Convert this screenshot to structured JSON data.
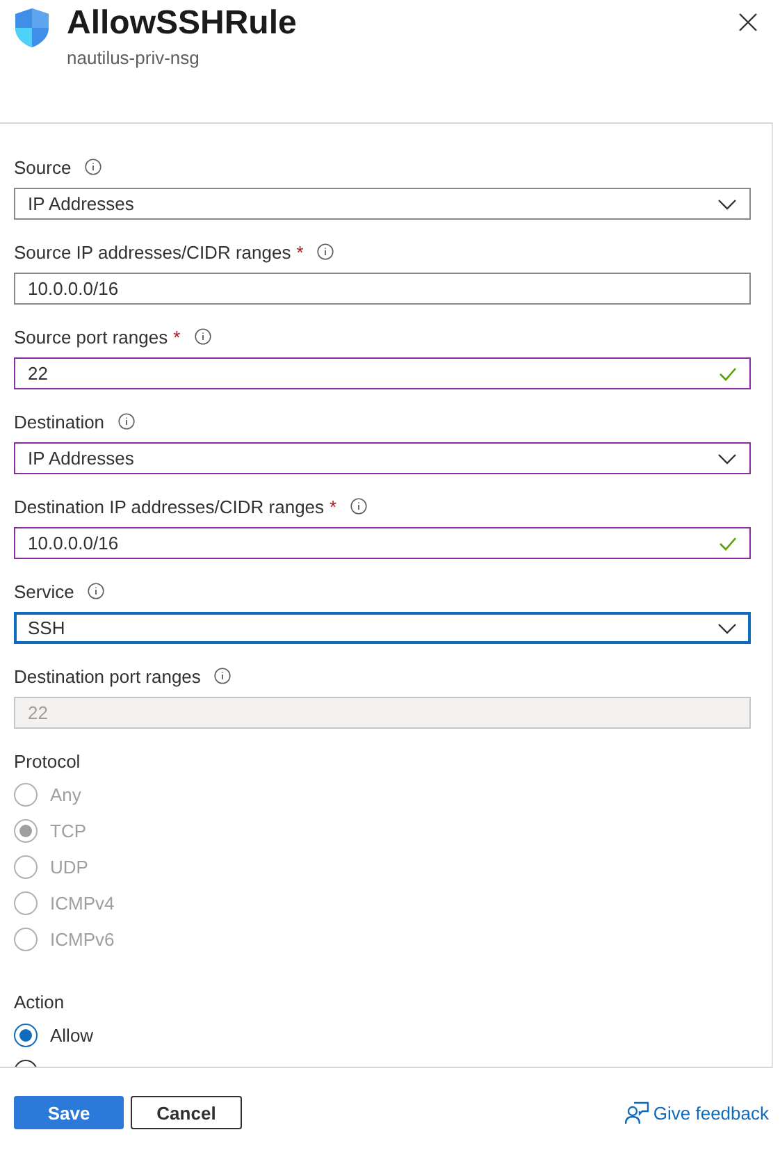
{
  "header": {
    "title": "AllowSSHRule",
    "subtitle": "nautilus-priv-nsg"
  },
  "fields": [
    {
      "label": "Source",
      "kind": "dropdown",
      "value": "IP Addresses",
      "highlighted": false,
      "valid": false,
      "focused": false,
      "disabled": false
    },
    {
      "label": "Source IP addresses/CIDR ranges",
      "required_mark": "*",
      "kind": "text",
      "value": "10.0.0.0/16",
      "highlighted": false,
      "valid": false,
      "focused": false,
      "disabled": false
    },
    {
      "label": "Source port ranges",
      "required_mark": "*",
      "kind": "text",
      "value": "22",
      "highlighted": true,
      "valid": true,
      "focused": false,
      "disabled": false
    },
    {
      "label": "Destination",
      "kind": "dropdown",
      "value": "IP Addresses",
      "highlighted": true,
      "valid": false,
      "focused": false,
      "disabled": false
    },
    {
      "label": "Destination IP addresses/CIDR ranges",
      "required_mark": "*",
      "kind": "text",
      "value": "10.0.0.0/16",
      "highlighted": true,
      "valid": true,
      "focused": false,
      "disabled": false
    },
    {
      "label": "Service",
      "kind": "dropdown",
      "value": "SSH",
      "highlighted": false,
      "valid": false,
      "focused": true,
      "disabled": false
    },
    {
      "label": "Destination port ranges",
      "kind": "text",
      "value": "22",
      "highlighted": false,
      "valid": false,
      "focused": false,
      "disabled": true
    }
  ],
  "protocol": {
    "label": "Protocol",
    "disabled": true,
    "options": [
      {
        "label": "Any",
        "selected": false
      },
      {
        "label": "TCP",
        "selected": true
      },
      {
        "label": "UDP",
        "selected": false
      },
      {
        "label": "ICMPv4",
        "selected": false
      },
      {
        "label": "ICMPv6",
        "selected": false
      }
    ]
  },
  "action": {
    "label": "Action",
    "disabled": false,
    "options": [
      {
        "label": "Allow",
        "selected": true
      },
      {
        "selected": false
      }
    ]
  },
  "footer": {
    "buttons": [
      {
        "label": "Save",
        "kind": "primary"
      },
      {
        "label": "Cancel",
        "kind": "secondary"
      }
    ],
    "feedback": "Give feedback"
  }
}
